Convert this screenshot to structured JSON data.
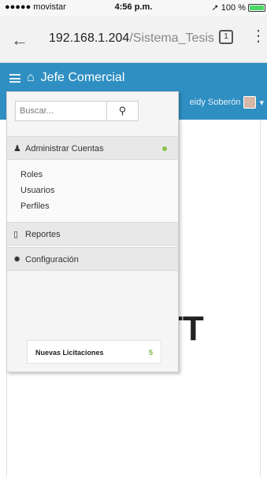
{
  "status_bar": {
    "carrier": "●●●●● movistar",
    "time": "4:56 p.m.",
    "battery": "100 %",
    "battery_level": 1.0
  },
  "browser": {
    "address_host": "192.168.1.204",
    "address_path": "/Sistema_Tesis",
    "tab_count": "1"
  },
  "app": {
    "title": "Jefe Comercial",
    "user_name": "eidy Soberón"
  },
  "background": {
    "big_text": "TT"
  },
  "menu": {
    "search_placeholder": "Buscar...",
    "sections": [
      {
        "label": "Administrar Cuentas"
      },
      {
        "label": "Reportes"
      },
      {
        "label": "Configuración"
      }
    ],
    "sub_items": [
      "Roles",
      "Usuarios",
      "Perfiles"
    ],
    "card": {
      "title": "Nuevas Licitaciones",
      "count": "5"
    }
  },
  "colors": {
    "appbar": "#2f8fc2",
    "status_dot": "#8bc34a",
    "badge_count": "#7cb342"
  }
}
